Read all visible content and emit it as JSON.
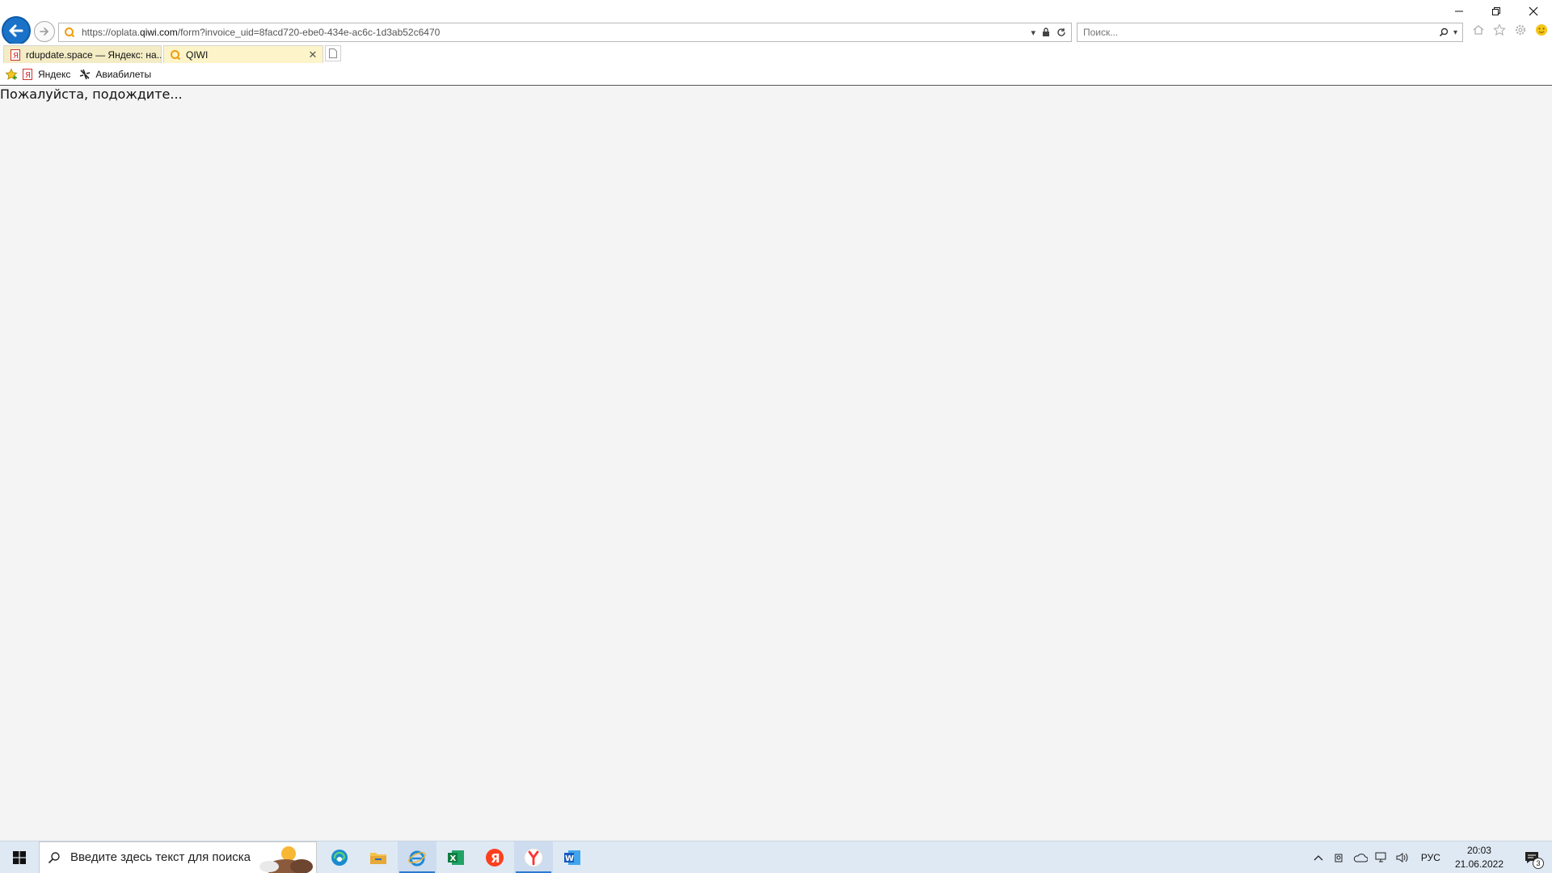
{
  "browser": {
    "address_url_prefix": "https://oplata.",
    "address_url_domain": "qiwi.com",
    "address_url_path": "/form?invoice_uid=8facd720-ebe0-434e-ac6c-1d3ab52c6470",
    "search_placeholder": "Поиск...",
    "tabs": [
      {
        "label": "rdupdate.space — Яндекс: на..."
      },
      {
        "label": "QIWI"
      }
    ],
    "favorites": [
      {
        "label": "Яндекс"
      },
      {
        "label": "Авиабилеты"
      }
    ]
  },
  "page": {
    "message": "Пожалуйста, подождите..."
  },
  "taskbar": {
    "search_placeholder": "Введите здесь текст для поиска",
    "language": "РУС",
    "time": "20:03",
    "date": "21.06.2022",
    "notification_count": "3"
  },
  "colors": {
    "accent": "#1a73c8",
    "taskbar_bg": "#dfe9f4",
    "tab_active_bg": "#fdf5c9"
  }
}
